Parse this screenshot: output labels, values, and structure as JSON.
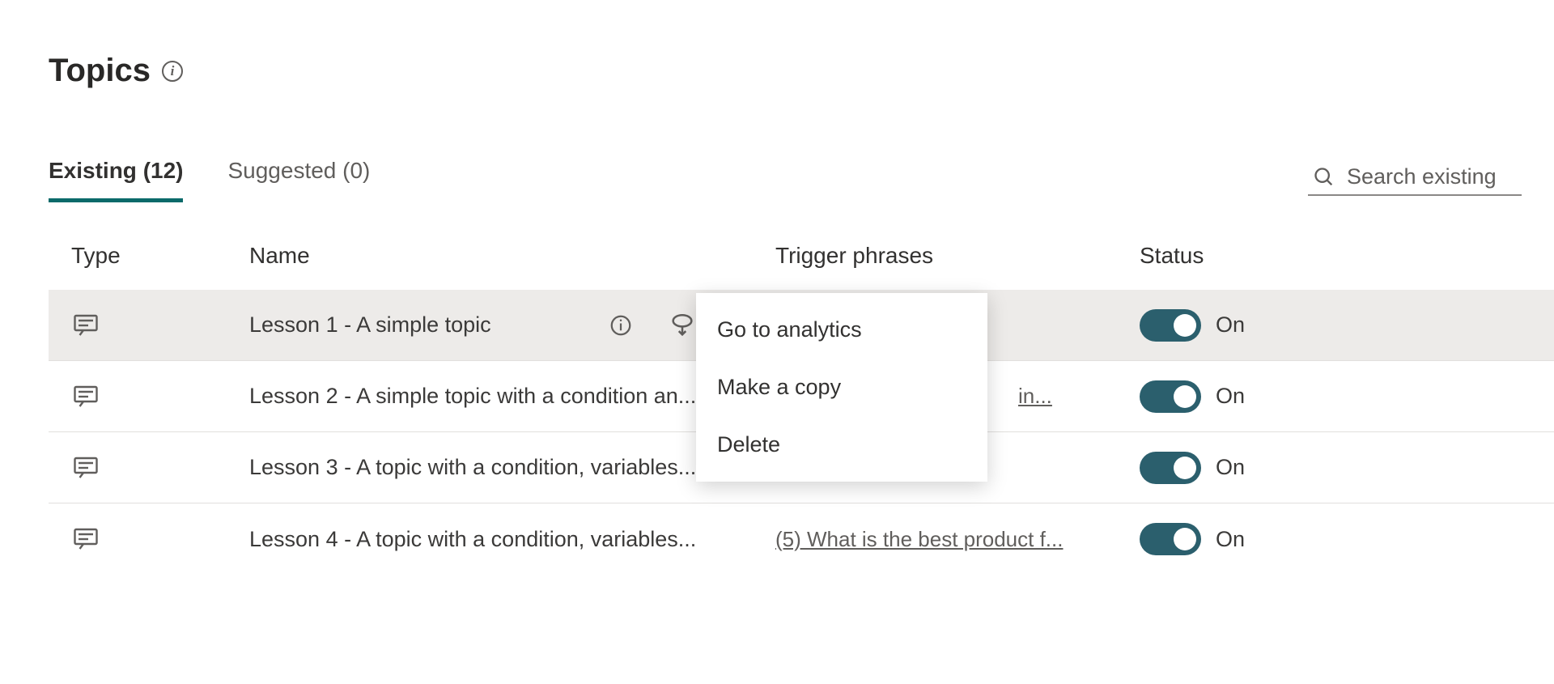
{
  "header": {
    "title": "Topics"
  },
  "tabs": {
    "existing_label": "Existing (12)",
    "suggested_label": "Suggested (0)"
  },
  "search": {
    "placeholder": "Search existing"
  },
  "columns": {
    "type": "Type",
    "name": "Name",
    "trigger": "Trigger phrases",
    "status": "Status"
  },
  "rows": [
    {
      "name": "Lesson 1 - A simple topic",
      "trigger": "",
      "status": "On"
    },
    {
      "name": "Lesson 2 - A simple topic with a condition an...",
      "trigger": "in...",
      "status": "On"
    },
    {
      "name": "Lesson 3 - A topic with a condition, variables...",
      "trigger": "",
      "status": "On"
    },
    {
      "name": "Lesson 4 - A topic with a condition, variables...",
      "trigger": "(5) What is the best product f...",
      "status": "On"
    }
  ],
  "menu": {
    "analytics": "Go to analytics",
    "copy": "Make a copy",
    "delete": "Delete"
  }
}
